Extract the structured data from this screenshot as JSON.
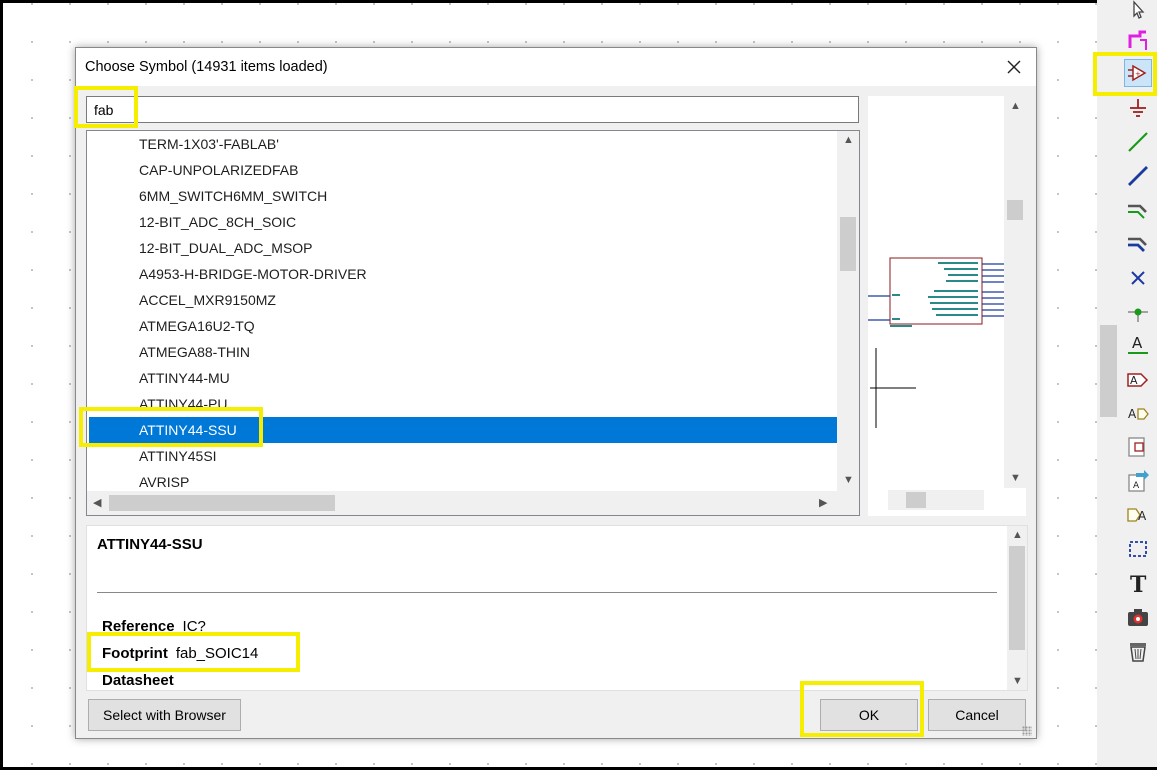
{
  "dialog": {
    "title": "Choose Symbol (14931 items loaded)",
    "search_value": "fab",
    "symbols": [
      "TERM-1X03'-FABLAB'",
      "CAP-UNPOLARIZEDFAB",
      "6MM_SWITCH6MM_SWITCH",
      "12-BIT_ADC_8CH_SOIC",
      "12-BIT_DUAL_ADC_MSOP",
      "A4953-H-BRIDGE-MOTOR-DRIVER",
      "ACCEL_MXR9150MZ",
      "ATMEGA16U2-TQ",
      "ATMEGA88-THIN",
      "ATTINY44-MU",
      "ATTINY44-PU",
      "ATTINY44-SSU",
      "ATTINY45SI",
      "AVRISP"
    ],
    "selected_index": 11,
    "details": {
      "name": "ATTINY44-SSU",
      "reference_label": "Reference",
      "reference_value": "IC?",
      "footprint_label": "Footprint",
      "footprint_value": "fab_SOIC14",
      "datasheet_label": "Datasheet"
    },
    "buttons": {
      "browser": "Select with Browser",
      "ok": "OK",
      "cancel": "Cancel"
    }
  },
  "toolbar_icons": [
    "pointer-icon",
    "highlight-net-icon",
    "add-symbol-icon",
    "add-power-icon",
    "add-wire-icon",
    "add-bus-icon",
    "wire-to-bus-entry-icon",
    "bus-to-bus-entry-icon",
    "no-connect-icon",
    "junction-icon",
    "net-label-icon",
    "global-label-icon",
    "hierarchical-label-icon",
    "hierarchical-sheet-icon",
    "import-sheet-pin-icon",
    "sheet-pin-icon",
    "graphic-lines-icon",
    "text-icon",
    "image-icon",
    "delete-icon"
  ],
  "colors": {
    "selection": "#0078d7",
    "highlight": "#f5ee00"
  }
}
